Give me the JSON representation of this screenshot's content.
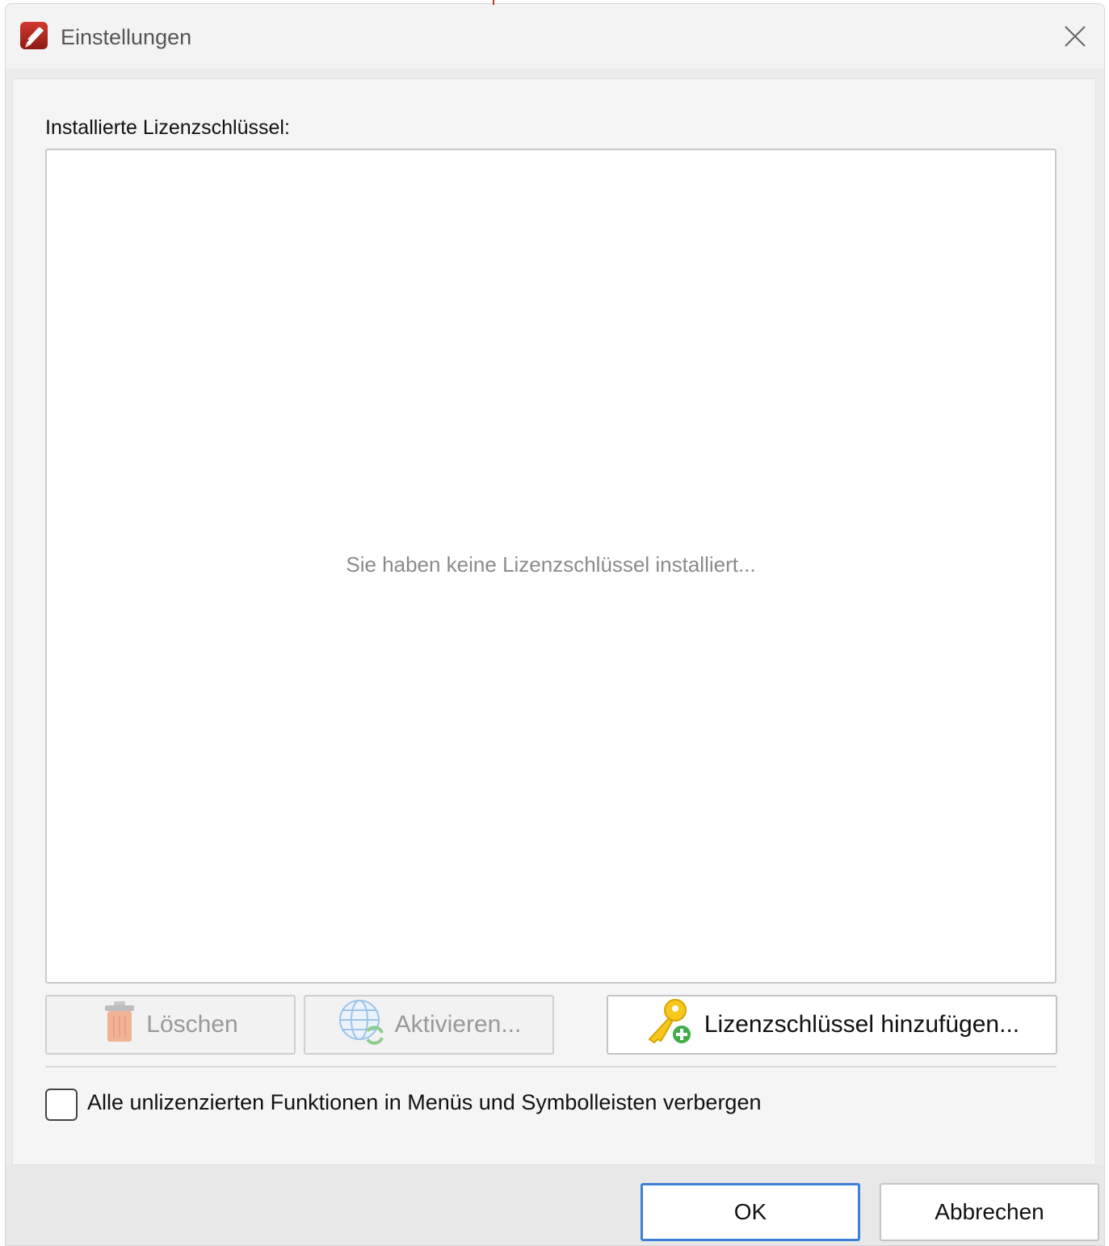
{
  "window": {
    "title": "Einstellungen"
  },
  "icons": {
    "app": "app-logo-icon",
    "close": "close-icon",
    "delete": "trash-icon",
    "activate": "globe-sync-icon",
    "add_key": "key-add-icon"
  },
  "license": {
    "list_label": "Installierte Lizenzschlüssel:",
    "empty_message": "Sie haben keine Lizenzschlüssel installiert...",
    "delete_label": "Löschen",
    "activate_label": "Aktivieren...",
    "add_key_label": "Lizenzschlüssel hinzufügen...",
    "hide_unlicensed_label": "Alle unlizenzierten Funktionen in Menüs und Symbolleisten verbergen",
    "hide_unlicensed_checked": false
  },
  "footer": {
    "ok_label": "OK",
    "cancel_label": "Abbrechen"
  },
  "colors": {
    "accent": "#3c7fd6",
    "app_red": "#b3241c"
  }
}
